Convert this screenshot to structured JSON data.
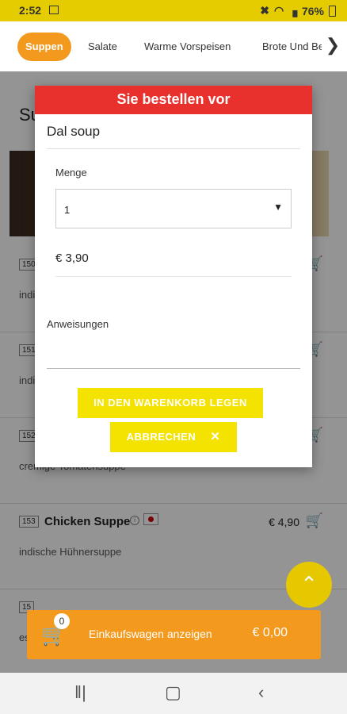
{
  "status_bar": {
    "time": "2:52",
    "battery": "76%"
  },
  "tabs": [
    {
      "label": "Suppen",
      "active": true
    },
    {
      "label": "Salate",
      "active": false
    },
    {
      "label": "Warme Vorspeisen",
      "active": false
    },
    {
      "label": "Brote Und Bei",
      "active": false
    }
  ],
  "tab_next_icon": "chevron-right-icon",
  "section_title": "Su",
  "menu_items": [
    {
      "num": "150",
      "name": "",
      "price": "",
      "desc": "indi"
    },
    {
      "num": "151",
      "name": "",
      "price": "",
      "desc": "indi"
    },
    {
      "num": "152",
      "name": "",
      "price": "",
      "desc": "cremige Tomatensuppe"
    },
    {
      "num": "153",
      "name": "Chicken Suppe",
      "price": "€ 4,90",
      "desc": "indische Hühnersuppe"
    },
    {
      "num": "15",
      "name": "",
      "price": "",
      "desc": "es"
    }
  ],
  "dialog": {
    "title": "Sie bestellen vor",
    "item_name": "Dal soup",
    "quantity_label": "Menge",
    "quantity_value": "1",
    "price": "€ 3,90",
    "instructions_label": "Anweisungen",
    "add_button": "IN DEN WARENKORB LEGEN",
    "cancel_button": "ABBRECHEN"
  },
  "cart": {
    "count": "0",
    "label": "Einkaufswagen anzeigen",
    "total": "€ 0,00"
  },
  "colors": {
    "accent": "#f39a1e",
    "yellow": "#f4e200",
    "header_red": "#e8312d",
    "status_bar": "#e4cc00"
  }
}
